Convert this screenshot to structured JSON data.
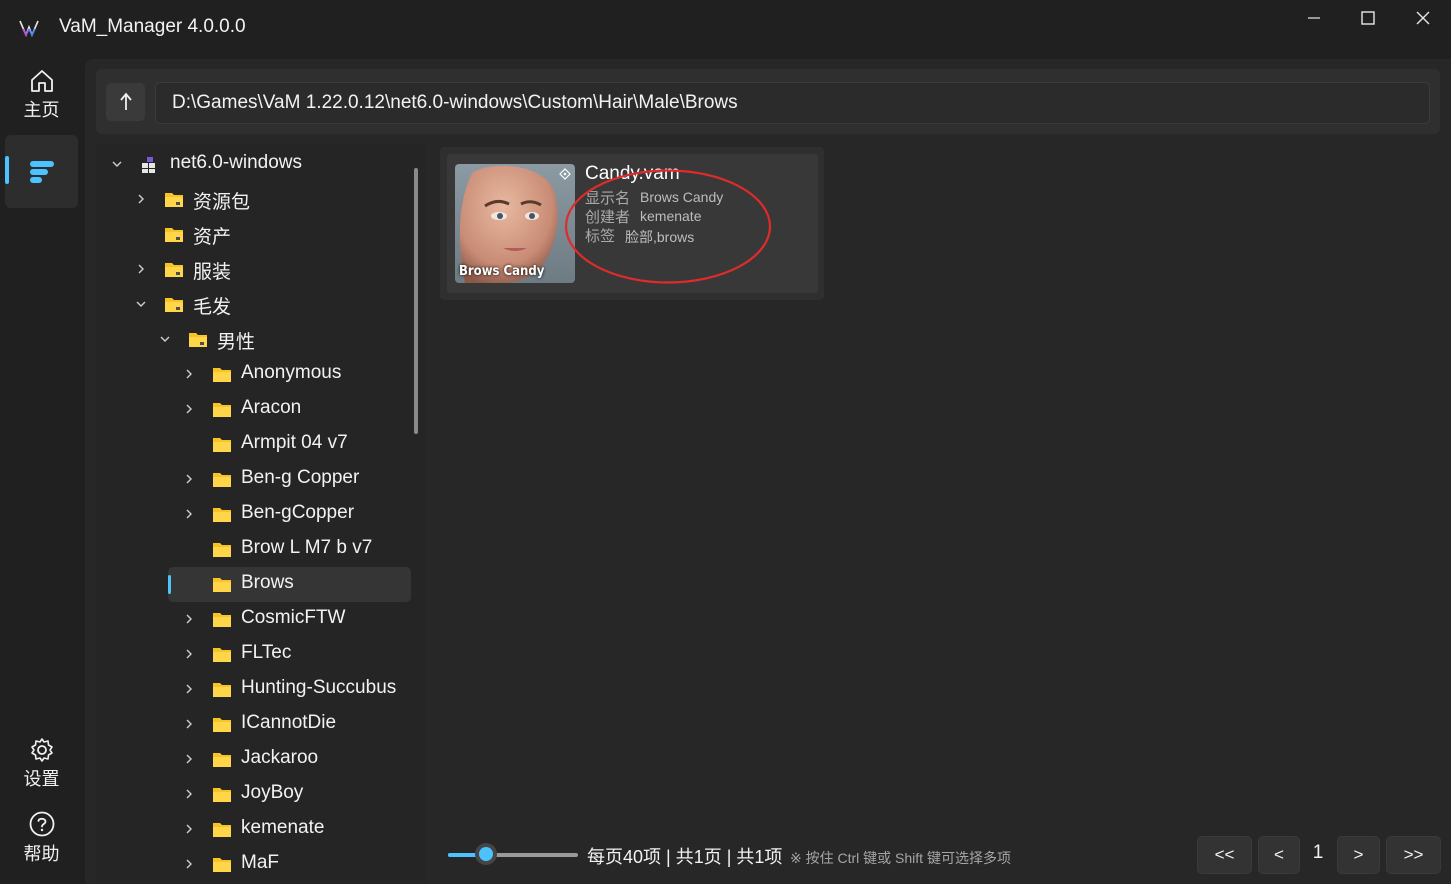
{
  "app": {
    "title": "VaM_Manager  4.0.0.0"
  },
  "nav": {
    "home_label": "主页",
    "settings_label": "设置",
    "help_label": "帮助",
    "accent": "#4cc2ff"
  },
  "path": {
    "value": "D:\\Games\\VaM 1.22.0.12\\net6.0-windows\\Custom\\Hair\\Male\\Brows"
  },
  "tree": {
    "root": "net6.0-windows",
    "items": [
      {
        "label": "资源包"
      },
      {
        "label": "资产"
      },
      {
        "label": "服装"
      },
      {
        "label": "毛发"
      },
      {
        "label": "男性"
      },
      {
        "label": "Anonymous"
      },
      {
        "label": "Aracon"
      },
      {
        "label": "Armpit 04 v7"
      },
      {
        "label": "Ben-g Copper"
      },
      {
        "label": "Ben-gCopper"
      },
      {
        "label": "Brow L M7 b v7"
      },
      {
        "label": "Brows"
      },
      {
        "label": "CosmicFTW"
      },
      {
        "label": "FLTec"
      },
      {
        "label": "Hunting-Succubus"
      },
      {
        "label": "ICannotDie"
      },
      {
        "label": "Jackaroo"
      },
      {
        "label": "JoyBoy"
      },
      {
        "label": "kemenate"
      },
      {
        "label": "MaF"
      }
    ]
  },
  "file": {
    "name": "Candy.vam",
    "thumb_caption": "Brows Candy",
    "display_name_key": "显示名",
    "display_name": "Brows Candy",
    "creator_key": "创建者",
    "creator": "kemenate",
    "tags_key": "标签",
    "tags": "脸部,brows"
  },
  "footer": {
    "summary": "每页40项 | 共1页 | 共1项",
    "hint": "※ 按住 Ctrl 键或 Shift 键可选择多项",
    "first": "<<",
    "prev": "<",
    "page": "1",
    "next": ">",
    "last": ">>"
  }
}
